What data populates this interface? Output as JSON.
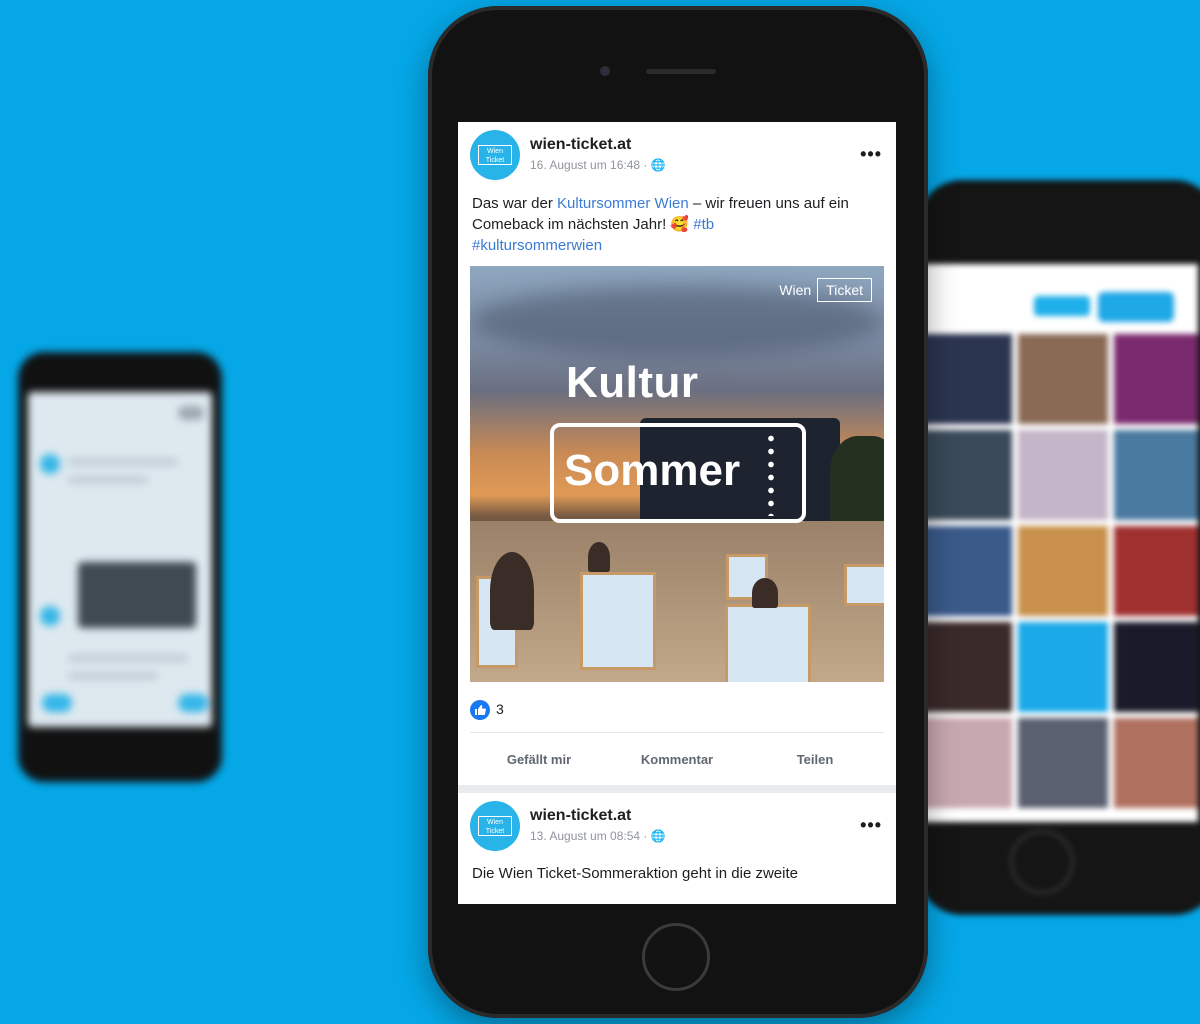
{
  "post1": {
    "page_name": "wien-ticket.at",
    "meta": "16. August um 16:48 · ",
    "text_before": "Das war der ",
    "text_link": "Kultursommer Wien",
    "text_middle": " – wir freuen uns auf ein Comeback im nächsten Jahr! 🥰 ",
    "hashtag1": "#tb",
    "hashtag2": "#kultursommerwien",
    "image": {
      "brand_left": "Wien",
      "brand_right": "Ticket",
      "headline1": "Kultur",
      "headline2": "Sommer"
    },
    "like_count": "3",
    "actions": {
      "like": "Gefällt mir",
      "comment": "Kommentar",
      "share": "Teilen"
    }
  },
  "post2": {
    "page_name": "wien-ticket.at",
    "meta": "13. August um 08:54 · ",
    "text": "Die Wien Ticket-Sommeraktion geht in die zweite"
  },
  "avatar_text": "Wien Ticket",
  "colors": {
    "background": "#05a7e6",
    "avatar": "#29b4e9",
    "link": "#3a7bd5",
    "like": "#1877f2"
  },
  "icons": [
    "more-icon",
    "globe-icon",
    "like-icon",
    "home-button"
  ]
}
